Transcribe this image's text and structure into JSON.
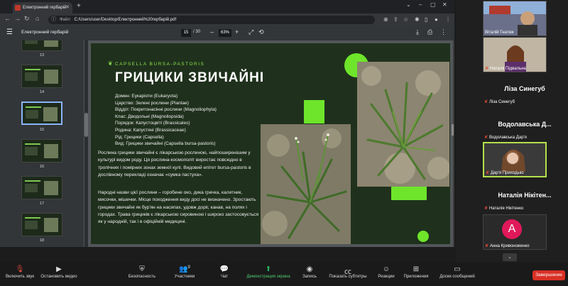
{
  "browser": {
    "tab_title": "Електронний гербарій",
    "address": "C:/Users/user/Desktop/Електронний%20гербарій.pdf",
    "address_prefix": "Файл"
  },
  "pdf": {
    "title": "Електронний гербарій",
    "current_page": "15",
    "total_pages": "/ 30",
    "zoom": "63%",
    "thumbnails": [
      {
        "num": "13"
      },
      {
        "num": "14"
      },
      {
        "num": "15"
      },
      {
        "num": "16"
      },
      {
        "num": "17"
      },
      {
        "num": "18"
      }
    ]
  },
  "slide": {
    "latin_name": "CAPSELLA BURSA-PASTORIS",
    "title": "ГРИЦИКИ ЗВИЧАЙНІ",
    "taxonomy": [
      "Домен: Еукаріоти (Eukaryota)",
      "Царство: Зелені рослини (Plantae)",
      "Відділ: Покритонасінні рослини (Magnoliophyta)",
      "Клас: Дводольні (Magnoliopsida)",
      "Порядок: Капустоцвіті (Brassicales)",
      "Родина: Капустяні (Brassicaceae)",
      "Рід: Грицики (Capsella)",
      "Вид: Грицики звичайні (Capsella bursa-pastoris)"
    ],
    "paragraph1": "Рослина грицики звичайні є лікарською рослиною, найпоширенішим у культурі видом роду. Ця рослина-космополіт виростає повсюдно в тропічних і помірних зонах земної кулі. Видовий епітет bursa-pastoris в дослівному перекладі означає «сумка пастуха».",
    "paragraph2": "Народні назви цієї рослини – горобине око, дика гречка, калитник, мисочки, мішечки. Місце походження виду досі не визначено. Зростають грицики звичайні як бур'ян на насипах, удовж доріг, канав, на полях і городах. Трава грициків є лікарською сировиною і широко застосовується як у народній, так і в офіційній медицині."
  },
  "participants": {
    "p1": "Віталій Гнатюк",
    "p2": "Наталя Підвальна",
    "p3_big": "Ліза Синегуб",
    "p3": "Ліза Синегуб",
    "p4_big": "Водолавська Д...",
    "p4": "Водолавська Дар'я",
    "p5": "Дар'я Приходько",
    "p6_big": "Наталія Нікітен...",
    "p6": "Наталія Нікітенко",
    "p7_initial": "А",
    "p7": "Анна Кривоноженко"
  },
  "zoom_bar": {
    "mute": "Включить звук",
    "video": "Остановить видео",
    "security": "Безопасность",
    "participants": "Участники",
    "participants_count": "9",
    "chat": "Чат",
    "share": "Демонстрация экрана",
    "record": "Запись",
    "captions": "Показать субтитры",
    "reactions": "Реакции",
    "apps": "Приложения",
    "whiteboards": "Доски сообщений",
    "end": "Завершение"
  },
  "colors": {
    "slide_bg": "#1f311c",
    "accent_green": "#6ee52a",
    "end_red": "#d93025"
  }
}
